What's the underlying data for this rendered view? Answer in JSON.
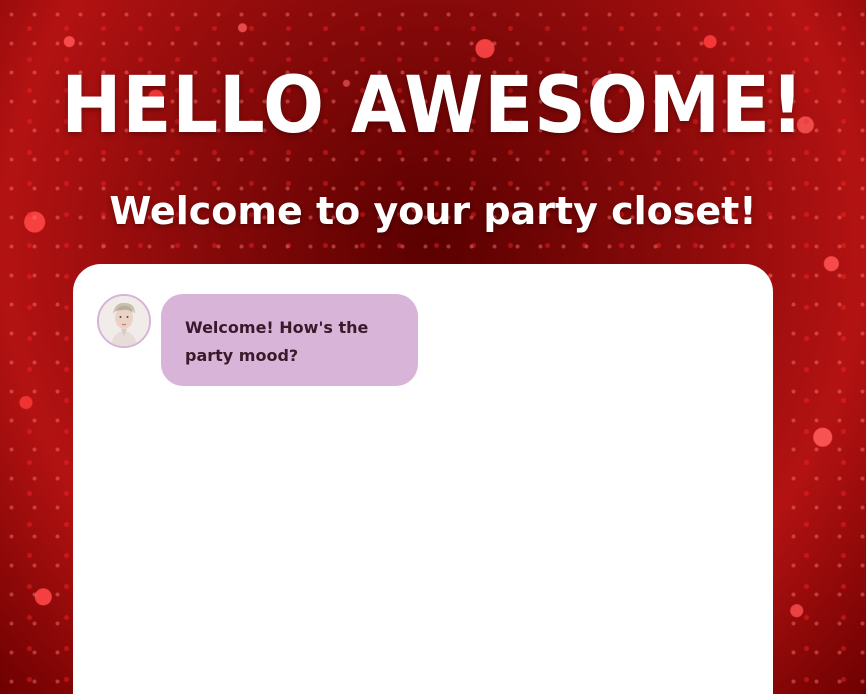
{
  "hero": {
    "title": "HELLO AWESOME!",
    "subtitle": "Welcome to your party closet!"
  },
  "chat": {
    "messages": [
      {
        "sender_avatar_icon": "person-portrait-icon",
        "text": "Welcome! How's the party mood?"
      }
    ]
  },
  "colors": {
    "background_accent": "#b31212",
    "panel": "#ffffff",
    "bubble": "#d8b4d9",
    "avatar_border": "#d7b3d8",
    "text_on_bubble": "#3a1a2a"
  }
}
